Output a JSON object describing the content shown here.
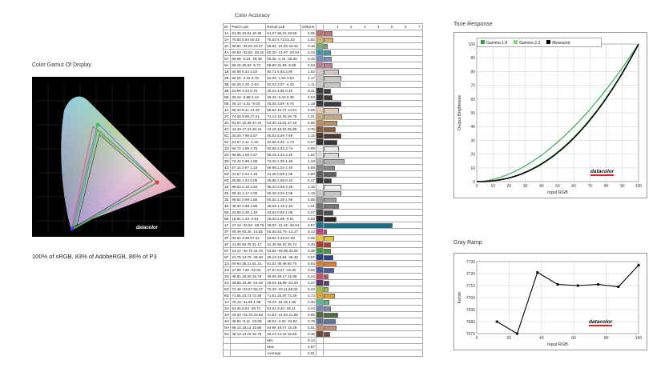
{
  "gamut": {
    "title": "Color Gamut Of Display",
    "caption": "100% of sRGB, 83% of AdobeRGB, 86% of P3",
    "brand": "datacolor"
  },
  "accuracy": {
    "title": "Color Accuracy",
    "headers": [
      "ID",
      "Patch Lab",
      "Result Lab",
      "Delta-E"
    ],
    "axis_ticks": [
      "1",
      "2",
      "3",
      "4",
      "5",
      "6",
      "7"
    ],
    "rows": [
      {
        "id": "1A",
        "patch": "61.35  34.81  18.38",
        "result": "61.27  36.15  18.56",
        "de": 0.55,
        "color": "#b9756e"
      },
      {
        "id": "2A",
        "patch": "75.50   5.84  50.42",
        "result": "75.53   6.73  51.02",
        "de": 0.6,
        "color": "#cfb06b"
      },
      {
        "id": "3A",
        "patch": "66.82 -25.04  23.47",
        "result": "66.66 -24.80  23.43",
        "de": 0.18,
        "color": "#7fa878"
      },
      {
        "id": "4A",
        "patch": "60.53 -22.62 -20.40",
        "result": "60.30 -21.97 -20.54",
        "de": 0.43,
        "color": "#3f9aaa"
      },
      {
        "id": "5A",
        "patch": "59.66  -2.03 -28.46",
        "result": "59.35  -1.44 -29.05",
        "de": 0.46,
        "color": "#7f8ebb"
      },
      {
        "id": "6A",
        "patch": "59.15  30.83  -5.72",
        "result": "58.98  31.99  -5.59",
        "de": 0.53,
        "color": "#ba7f97"
      },
      {
        "id": "1B",
        "patch": "82.68   5.03   3.02",
        "result": "82.71   5.93   2.85",
        "de": 1.02,
        "color": "#d4c8c4"
      },
      {
        "id": "2B",
        "patch": "82.25  -2.42   3.78",
        "result": "82.20  -1.53   3.63",
        "de": 1.17,
        "color": "#c9c8c2"
      },
      {
        "id": "3B",
        "patch": "82.29   2.20  -2.04",
        "result": "82.23   3.07  -2.28",
        "de": 1.11,
        "color": "#cbc8cc"
      },
      {
        "id": "4B",
        "patch": "24.89   4.43   0.78",
        "result": "25.24   4.60   0.49",
        "de": 0.41,
        "color": "#413b3a"
      },
      {
        "id": "5B",
        "patch": "25.16  -3.88   2.13",
        "result": "25.43  -3.42   2.30",
        "de": 0.53,
        "color": "#383d38"
      },
      {
        "id": "6B",
        "patch": "26.13  -2.61  -5.03",
        "result": "26.05   3.50  -5.70",
        "de": 1.18,
        "color": "#373c44"
      },
      {
        "id": "1C",
        "patch": "85.42   9.41  14.49",
        "result": "85.52  10.47  14.61",
        "de": 0.99,
        "color": "#e3c9b2"
      },
      {
        "id": "2C",
        "patch": "74.28   9.05  27.21",
        "result": "74.12  10.40  26.75",
        "de": 1.21,
        "color": "#c7a882"
      },
      {
        "id": "3C",
        "patch": "64.57  12.39  37.24",
        "result": "64.30  13.61  37.43",
        "de": 0.86,
        "color": "#b98f5e"
      },
      {
        "id": "4C",
        "patch": "44.49  17.23  26.24",
        "result": "44.16  18.52  25.85",
        "de": 0.76,
        "color": "#8a5d41"
      },
      {
        "id": "5C",
        "patch": "25.29   7.95   8.87",
        "result": "25.53   8.36   7.68",
        "de": 1.15,
        "color": "#4b3932"
      },
      {
        "id": "6C",
        "patch": "22.67   2.11  -1.10",
        "result": "22.86   2.62  -1.73",
        "de": 0.87,
        "color": "#373536"
      },
      {
        "id": "1D",
        "patch": "92.72   1.89   2.76",
        "result": "92.88   2.63   2.74",
        "de": 0.99,
        "color": "#ede9e6"
      },
      {
        "id": "2D",
        "patch": "88.85   1.59   2.27",
        "result": "89.15   2.32   2.20",
        "de": 1.02,
        "color": "#dfdcd9"
      },
      {
        "id": "3D",
        "patch": "73.42   0.99   1.89",
        "result": "73.26   1.95   1.45",
        "de": 1.43,
        "color": "#b5b3b1"
      },
      {
        "id": "4D",
        "patch": "57.15   0.57   1.19",
        "result": "56.98   1.04   1.19",
        "de": 0.69,
        "color": "#8a8988"
      },
      {
        "id": "5D",
        "patch": "41.57   0.24   1.45",
        "result": "41.28   0.69   1.09",
        "de": 0.8,
        "color": "#626160"
      },
      {
        "id": "6D",
        "patch": "25.65   1.24   0.05",
        "result": "25.88   1.56   0.10",
        "de": 0.47,
        "color": "#3d3c3c"
      },
      {
        "id": "1E",
        "patch": "96.04   2.16   2.60",
        "result": "96.23   2.96   2.26",
        "de": 1.15,
        "color": "#f7f3f0"
      },
      {
        "id": "2E",
        "patch": "80.44   1.17   2.05",
        "result": "80.49   2.04   2.08",
        "de": 1.19,
        "color": "#c9c6c3"
      },
      {
        "id": "3E",
        "patch": "65.52   0.69   1.86",
        "result": "65.50   1.29   1.95",
        "de": 0.85,
        "color": "#a09e9c"
      },
      {
        "id": "4E",
        "patch": "49.62   0.58   1.56",
        "result": "49.29   1.19   1.20",
        "de": 1.01,
        "color": "#777674"
      },
      {
        "id": "5E",
        "patch": "33.55   0.35   1.40",
        "result": "33.52   0.68   1.09",
        "de": 0.57,
        "color": "#4f4e4d"
      },
      {
        "id": "6E",
        "patch": "16.91   1.43  -0.81",
        "result": "18.03   1.56  -0.51",
        "de": 0.83,
        "color": "#2a292a"
      },
      {
        "id": "1F",
        "patch": "47.12 -32.52 -28.75",
        "result": "48.00 -21.45 -26.64",
        "de": 4.97,
        "color": "#17718a"
      },
      {
        "id": "2F",
        "patch": "50.49  53.45 -13.55",
        "result": "50.59  53.73 -13.47",
        "de": 0.14,
        "color": "#bb4386"
      },
      {
        "id": "3F",
        "patch": "83.61   3.36  87.02",
        "result": "83.82   4.49  87.28",
        "de": 0.65,
        "color": "#e5c53b"
      },
      {
        "id": "4F",
        "patch": "41.05  60.75  31.17",
        "result": "41.45  60.32  30.74",
        "de": 0.4,
        "color": "#b13a3b"
      },
      {
        "id": "5F",
        "patch": "54.14 -40.76  34.75",
        "result": "53.89 -39.96  34.08",
        "de": 0.39,
        "color": "#4d9640"
      },
      {
        "id": "6F",
        "patch": "24.75  13.78 -49.48",
        "result": "25.13  13.84 -48.49",
        "de": 0.57,
        "color": "#2b3f8e"
      },
      {
        "id": "1G",
        "patch": "60.94  38.21  61.31",
        "result": "61.02  39.48  60.70",
        "de": 0.84,
        "color": "#d67d2f"
      },
      {
        "id": "2G",
        "patch": "37.80   7.30 -43.04",
        "result": "37.67   8.27 -43.30",
        "de": 0.62,
        "color": "#4a5ca0"
      },
      {
        "id": "3G",
        "patch": "49.81  48.50  15.76",
        "result": "49.69  49.17  15.88",
        "de": 0.24,
        "color": "#c1525f"
      },
      {
        "id": "4G",
        "patch": "28.88  19.36 -24.48",
        "result": "29.04  18.98 -24.03",
        "de": 0.27,
        "color": "#5b3b6a"
      },
      {
        "id": "5G",
        "patch": "72.45 -23.57  60.47",
        "result": "72.28 -23.11  60.00",
        "de": 0.24,
        "color": "#9ebc44"
      },
      {
        "id": "6G",
        "patch": "71.65  23.74  72.28",
        "result": "71.81  25.00  72.29",
        "de": 0.73,
        "color": "#e19f2c"
      },
      {
        "id": "1H",
        "patch": "70.19 -31.85   1.98",
        "result": "70.10 -31.36   1.65",
        "de": 0.3,
        "color": "#5bb796"
      },
      {
        "id": "2H",
        "patch": "54.38   8.84 -25.71",
        "result": "54.04   9.33 -26.11",
        "de": 0.44,
        "color": "#7e84ab"
      },
      {
        "id": "3H",
        "patch": "42.03 -15.78  22.93",
        "result": "41.53 -14.53  21.69",
        "de": 0.95,
        "color": "#546a3f"
      },
      {
        "id": "4H",
        "patch": "48.82  -5.11 -23.08",
        "result": "48.53  -4.26 -23.52",
        "de": 0.78,
        "color": "#5d789a"
      },
      {
        "id": "5H",
        "patch": "65.10  18.14  18.68",
        "result": "64.96  19.07  18.26",
        "de": 0.81,
        "color": "#bd8d7b"
      },
      {
        "id": "6H",
        "patch": "36.13  14.15  15.78",
        "result": "36.12  14.42  15.50",
        "de": 0.35,
        "color": "#6f4b3e"
      }
    ],
    "stats": [
      {
        "label": "Min",
        "value": "0.14"
      },
      {
        "label": "Max",
        "value": "4.97"
      },
      {
        "label": "Average",
        "value": "0.81"
      }
    ]
  },
  "tone": {
    "title": "Tone Response",
    "xlabel": "Input RGB",
    "ylabel": "Output Brightness",
    "brand": "datacolor",
    "legend": [
      "Gamma 1.8",
      "Gamma 2.2",
      "Measured"
    ]
  },
  "ramp": {
    "title": "Gray Ramp",
    "xlabel": "Input RGB",
    "ylabel": "Kelvin",
    "brand": "datacolor"
  },
  "chart_data": [
    {
      "type": "line",
      "title": "Tone Response",
      "xlabel": "Input RGB",
      "ylabel": "Output Brightness",
      "xlim": [
        0,
        100
      ],
      "ylim": [
        0,
        100
      ],
      "xticks": [
        0,
        10,
        20,
        30,
        40,
        50,
        60,
        70,
        80,
        90,
        100
      ],
      "yticks": [
        0,
        10,
        20,
        30,
        40,
        50,
        60,
        70,
        80,
        90,
        100
      ],
      "x": [
        0,
        10,
        20,
        30,
        40,
        50,
        60,
        70,
        80,
        90,
        100
      ],
      "series": [
        {
          "name": "Gamma 1.8",
          "color": "#2aa44a",
          "values": [
            0,
            1.6,
            5.5,
            11.5,
            19.2,
            28.7,
            39.9,
            52.6,
            66.9,
            82.7,
            100
          ]
        },
        {
          "name": "Gamma 2.2",
          "color": "#7be07b",
          "values": [
            0,
            0.6,
            2.9,
            7.1,
            13.3,
            21.8,
            32.5,
            45.6,
            61.2,
            79.3,
            100
          ]
        },
        {
          "name": "Measured",
          "color": "#000000",
          "values": [
            0,
            0.7,
            3.0,
            7.0,
            13.0,
            21.0,
            31.5,
            44.5,
            60.0,
            78.5,
            100
          ]
        }
      ],
      "legend_position": "top-left",
      "grid": true
    },
    {
      "type": "line",
      "title": "Gray Ramp",
      "xlabel": "Input RGB",
      "ylabel": "Kelvin",
      "xlim": [
        0,
        100
      ],
      "ylim": [
        7670,
        7730
      ],
      "xticks": [
        0,
        20,
        40,
        60,
        80,
        100
      ],
      "yticks": [
        7670,
        7680,
        7690,
        7700,
        7710,
        7720,
        7730
      ],
      "x": [
        12.5,
        25,
        37.5,
        50,
        62.5,
        75,
        87.5,
        100
      ],
      "series": [
        {
          "name": "",
          "color": "#000000",
          "values": [
            7680,
            7670,
            7721,
            7711,
            7710,
            7711,
            7709,
            7727
          ]
        }
      ],
      "grid": true
    }
  ]
}
